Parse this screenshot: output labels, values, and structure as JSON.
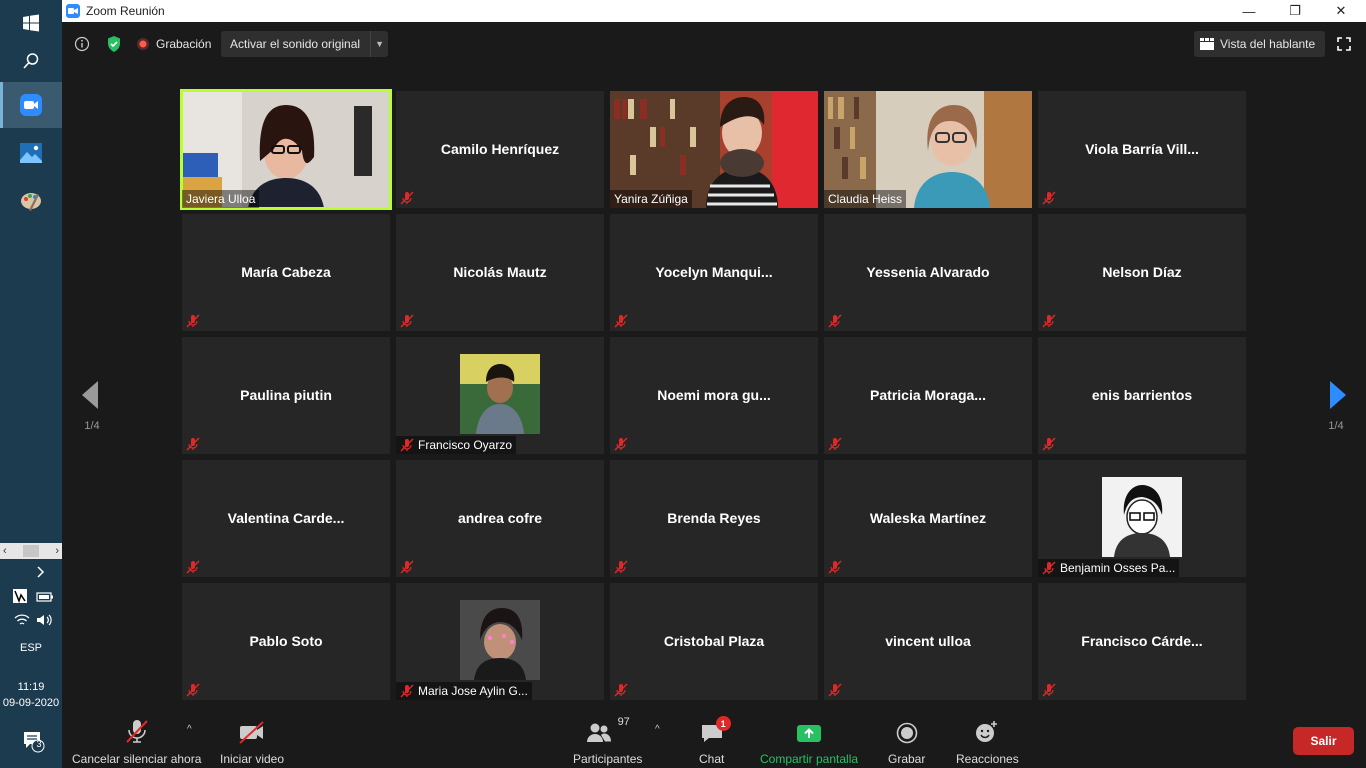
{
  "window": {
    "title": "Zoom Reunión",
    "minimize": "—",
    "maximize": "❐",
    "close": "✕"
  },
  "taskbar": {
    "language": "ESP",
    "time": "11:19",
    "date": "09-09-2020",
    "notifications_count": "3"
  },
  "topbar": {
    "recording_label": "Grabación",
    "audio_button": "Activar el sonido original",
    "speaker_view": "Vista del hablante"
  },
  "gallery": {
    "page_prev": "1/4",
    "page_next": "1/4",
    "participants": [
      {
        "name": "Javiera Ulloa",
        "video": true,
        "active": true
      },
      {
        "name": "Camilo Henríquez",
        "video": false
      },
      {
        "name": "Yanira Zúñiga",
        "video": true
      },
      {
        "name": "Claudia Heiss",
        "video": true
      },
      {
        "name": "Viola  Barría  Vill...",
        "video": false
      },
      {
        "name": "María Cabeza",
        "video": false
      },
      {
        "name": "Nicolás Mautz",
        "video": false
      },
      {
        "name": "Yocelyn  Manqui...",
        "video": false
      },
      {
        "name": "Yessenia Alvarado",
        "video": false
      },
      {
        "name": "Nelson Díaz",
        "video": false
      },
      {
        "name": "Paulina piutin",
        "video": false
      },
      {
        "name": "Francisco Oyarzo",
        "video": false,
        "avatar": true
      },
      {
        "name": "Noemi  mora  gu...",
        "video": false
      },
      {
        "name": "Patricia  Moraga...",
        "video": false
      },
      {
        "name": "enis barrientos",
        "video": false
      },
      {
        "name": "Valentina  Carde...",
        "video": false
      },
      {
        "name": "andrea cofre",
        "video": false
      },
      {
        "name": "Brenda Reyes",
        "video": false
      },
      {
        "name": "Waleska Martínez",
        "video": false
      },
      {
        "name": "Benjamin Osses Pa...",
        "video": false,
        "avatar": true
      },
      {
        "name": "Pablo Soto",
        "video": false
      },
      {
        "name": "Maria Jose Aylin G...",
        "video": false,
        "avatar": true
      },
      {
        "name": "Cristobal Plaza",
        "video": false
      },
      {
        "name": "vincent ulloa",
        "video": false
      },
      {
        "name": "Francisco  Cárde...",
        "video": false
      }
    ]
  },
  "bottombar": {
    "unmute": "Cancelar silenciar ahora",
    "start_video": "Iniciar video",
    "participants": "Participantes",
    "participants_count": "97",
    "chat": "Chat",
    "chat_badge": "1",
    "share": "Compartir pantalla",
    "record": "Grabar",
    "reactions": "Reacciones",
    "leave": "Salir"
  },
  "colors": {
    "active_speaker": "#b6ff30",
    "share_green": "#27c163",
    "leave_red": "#c62828",
    "zoom_blue": "#2d8cff"
  }
}
